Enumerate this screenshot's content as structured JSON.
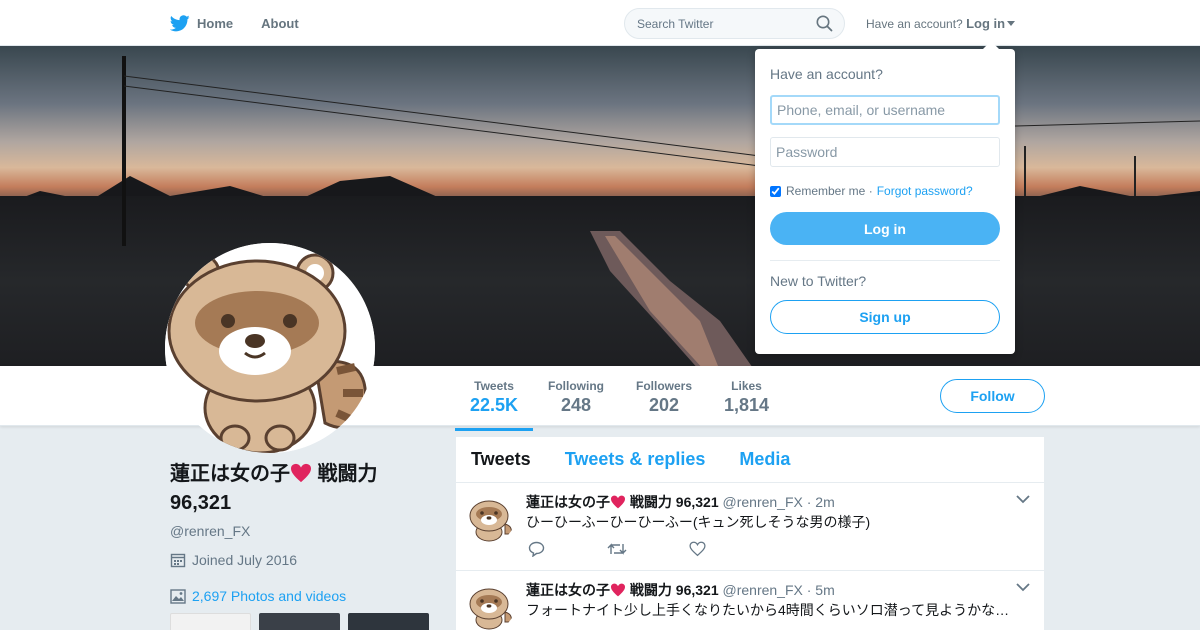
{
  "nav": {
    "brand_icon": "twitter-bird-icon",
    "home_label": "Home",
    "about_label": "About",
    "search_placeholder": "Search Twitter",
    "account_prompt": "Have an account?",
    "login_label": "Log in"
  },
  "colors": {
    "accent": "#1da1f2",
    "heart": "#e0245e",
    "background": "#e6ecf0"
  },
  "stats": [
    {
      "label": "Tweets",
      "value": "22.5K",
      "active": true
    },
    {
      "label": "Following",
      "value": "248",
      "active": false
    },
    {
      "label": "Followers",
      "value": "202",
      "active": false
    },
    {
      "label": "Likes",
      "value": "1,814",
      "active": false
    }
  ],
  "follow_label": "Follow",
  "profile": {
    "name_prefix": "蓮正は女の子",
    "name_suffix": " 戦闘力",
    "name_line2": "96,321",
    "screen_name": "@renren_FX",
    "joined": "Joined July 2016",
    "photos_label": "2,697 Photos and videos"
  },
  "timeline": {
    "tabs": [
      "Tweets",
      "Tweets & replies",
      "Media"
    ],
    "tweets": [
      {
        "fullname_prefix": "蓮正は女の子",
        "fullname_suffix": " 戦闘力 96,321",
        "handle": "@renren_FX",
        "time": "· 2m",
        "text": "ひーひーふーひーひーふー(キュン死しそうな男の様子)"
      },
      {
        "fullname_prefix": "蓮正は女の子",
        "fullname_suffix": " 戦闘力 96,321",
        "handle": "@renren_FX",
        "time": "· 5m",
        "text": "フォートナイト少し上手くなりたいから4時間くらいソロ潜って見ようかな…"
      }
    ]
  },
  "login_dropdown": {
    "title": "Have an account?",
    "username_placeholder": "Phone, email, or username",
    "password_placeholder": "Password",
    "remember_label": "Remember me ·",
    "forgot_label": "Forgot password?",
    "login_button": "Log in",
    "new_prompt": "New to Twitter?",
    "signup_button": "Sign up"
  }
}
